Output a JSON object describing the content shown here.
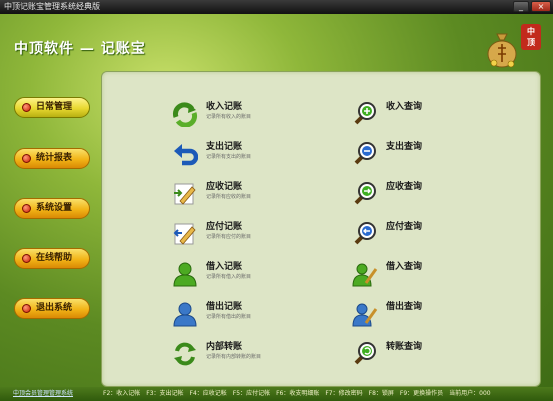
{
  "window": {
    "title": "中顶记账宝管理系统经典版",
    "min_label": "_",
    "close_label": "×"
  },
  "app": {
    "title": "中顶软件 — 记账宝",
    "seal": [
      "中",
      "顶"
    ]
  },
  "nav": [
    {
      "label": "日常管理",
      "active": true
    },
    {
      "label": "统计报表"
    },
    {
      "label": "系统设置"
    },
    {
      "label": "在线帮助"
    },
    {
      "label": "退出系统"
    }
  ],
  "left_items": [
    {
      "label": "收入记账",
      "sub": "记录所有收入的账目",
      "icon": "refresh-arrow-icon"
    },
    {
      "label": "支出记账",
      "sub": "记录所有支出的账目",
      "icon": "undo-arrow-icon"
    },
    {
      "label": "应收记账",
      "sub": "记录所有应收的账目",
      "icon": "edit-in-icon"
    },
    {
      "label": "应付记账",
      "sub": "记录所有应付的账目",
      "icon": "edit-out-icon"
    },
    {
      "label": "借入记账",
      "sub": "记录所有借入的账目",
      "icon": "person-green-icon"
    },
    {
      "label": "借出记账",
      "sub": "记录所有借出的账目",
      "icon": "person-blue-icon"
    },
    {
      "label": "内部转账",
      "sub": "记录所有内部转账的账目",
      "icon": "transfer-icon"
    }
  ],
  "right_items": [
    {
      "label": "收入查询",
      "icon": "zoom-in-icon"
    },
    {
      "label": "支出查询",
      "icon": "zoom-out-icon"
    },
    {
      "label": "应收查询",
      "icon": "search-next-icon"
    },
    {
      "label": "应付查询",
      "icon": "search-prev-icon"
    },
    {
      "label": "借入查询",
      "icon": "person-search-green-icon"
    },
    {
      "label": "借出查询",
      "icon": "person-search-blue-icon"
    },
    {
      "label": "转账查询",
      "icon": "search-transfer-icon"
    }
  ],
  "status": {
    "link": "中顶会员管理管理系统",
    "hotkeys": "F2：收入记帐　F3：支出记帐　F4：应收记帐　F5：应付记帐　F6：收支明细账　F7：修改密码　F8：锁屏　F9：更换操作员　当前用户：000"
  },
  "colors": {
    "accent_green": "#5c8a22",
    "nav_orange": "#f2b417",
    "panel_bg": "#dde5c6"
  }
}
